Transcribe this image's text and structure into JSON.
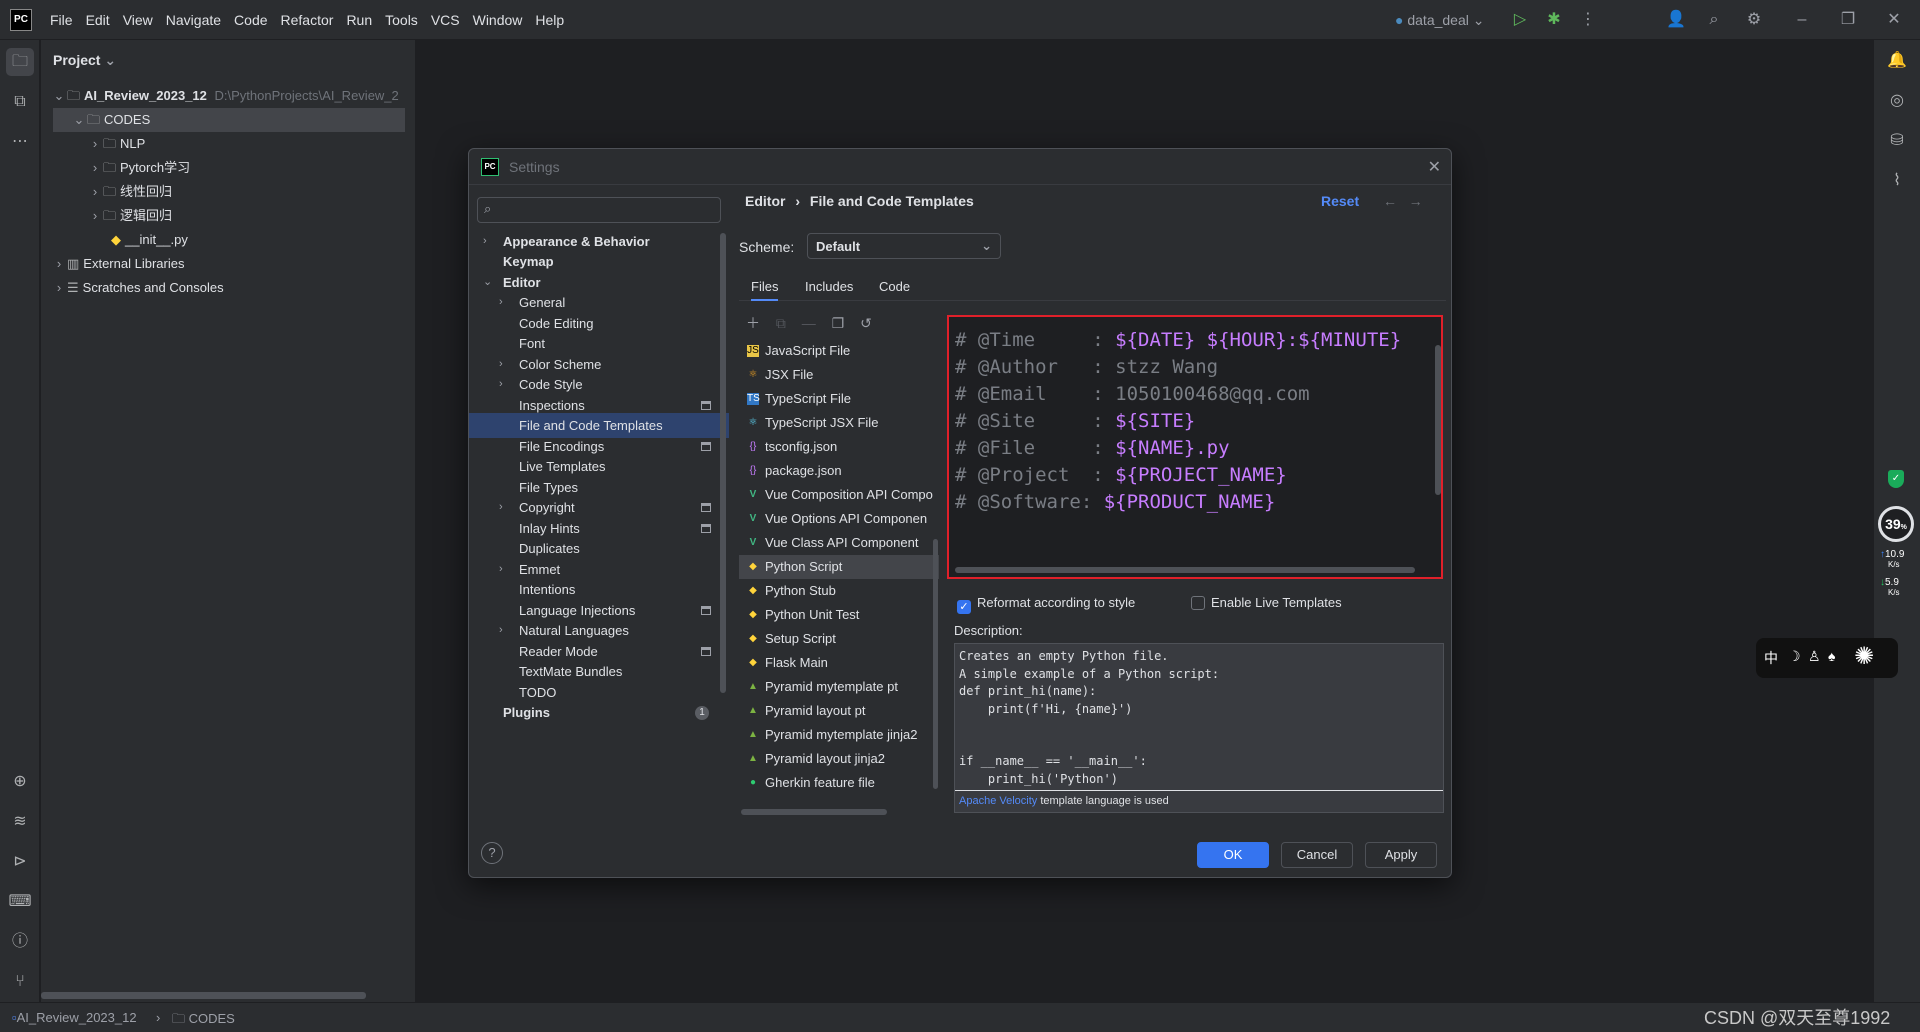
{
  "menu": [
    "File",
    "Edit",
    "View",
    "Navigate",
    "Code",
    "Refactor",
    "Run",
    "Tools",
    "VCS",
    "Window",
    "Help"
  ],
  "run_config": "data_deal",
  "project_panel": {
    "title": "Project",
    "root": {
      "name": "AI_Review_2023_12",
      "path": "D:\\PythonProjects\\AI_Review_2"
    },
    "codes": "CODES",
    "children": [
      "NLP",
      "Pytorch学习",
      "线性回归",
      "逻辑回归"
    ],
    "init_file": "__init__.py",
    "external_libraries": "External Libraries",
    "scratches": "Scratches and Consoles"
  },
  "dialog": {
    "title": "Settings",
    "tree": {
      "appearance": "Appearance & Behavior",
      "keymap": "Keymap",
      "editor": "Editor",
      "editor_items": [
        "General",
        "Code Editing",
        "Font",
        "Color Scheme",
        "Code Style",
        "Inspections",
        "File and Code Templates",
        "File Encodings",
        "Live Templates",
        "File Types",
        "Copyright",
        "Inlay Hints",
        "Duplicates",
        "Emmet",
        "Intentions",
        "Language Injections",
        "Natural Languages",
        "Reader Mode",
        "TextMate Bundles",
        "TODO"
      ],
      "plugins": "Plugins",
      "plugins_count": "1"
    },
    "breadcrumb": {
      "parent": "Editor",
      "current": "File and Code Templates"
    },
    "reset": "Reset",
    "scheme_label": "Scheme:",
    "scheme_value": "Default",
    "tabs": [
      "Files",
      "Includes",
      "Code"
    ],
    "files": [
      "JavaScript File",
      "JSX File",
      "TypeScript File",
      "TypeScript JSX File",
      "tsconfig.json",
      "package.json",
      "Vue Composition API Compo",
      "Vue Options API Componen",
      "Vue Class API Component",
      "Python Script",
      "Python Stub",
      "Python Unit Test",
      "Setup Script",
      "Flask Main",
      "Pyramid mytemplate pt",
      "Pyramid layout pt",
      "Pyramid mytemplate jinja2",
      "Pyramid layout jinja2",
      "Gherkin feature file"
    ],
    "template_lines": [
      {
        "key": "# @Time     : ",
        "value": "${DATE} ${HOUR}:${MINUTE}"
      },
      {
        "key": "# @Author   : stzz Wang",
        "value": ""
      },
      {
        "key": "# @Email    : 1050100468@qq.com",
        "value": ""
      },
      {
        "key": "# @Site     : ",
        "value": "${SITE}"
      },
      {
        "key": "# @File     : ",
        "value": "${NAME}.py"
      },
      {
        "key": "# @Project  : ",
        "value": "${PROJECT_NAME}"
      },
      {
        "key": "# @Software: ",
        "value": "${PRODUCT_NAME}"
      }
    ],
    "reformat_label": "Reformat according to style",
    "live_templates_label": "Enable Live Templates",
    "description_label": "Description:",
    "description_text": "Creates an empty Python file.\nA simple example of a Python script:\ndef print_hi(name):\n    print(f'Hi, {name}')\n\n\nif __name__ == '__main__':\n    print_hi('Python')",
    "velocity_link": "Apache Velocity",
    "velocity_suffix": " template language is used",
    "buttons": {
      "ok": "OK",
      "cancel": "Cancel",
      "apply": "Apply"
    }
  },
  "status_bar": {
    "project": "AI_Review_2023_12",
    "folder": "CODES"
  },
  "net_widget": {
    "percent": "39",
    "up": "10.9",
    "down": "5.9",
    "unit": "K/s"
  },
  "ime_bar": {
    "lang": "中"
  },
  "watermark": "CSDN @双天至尊1992"
}
